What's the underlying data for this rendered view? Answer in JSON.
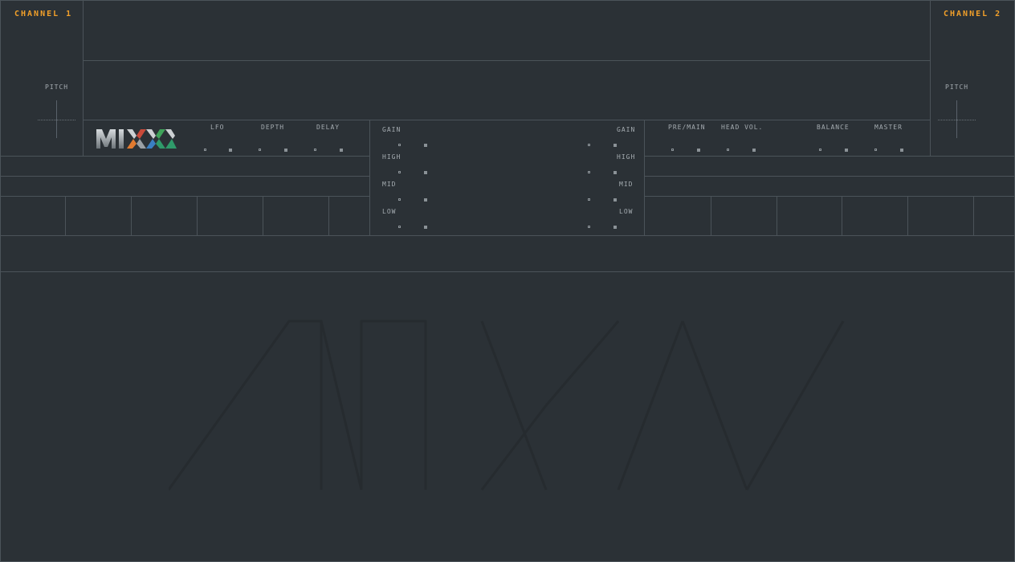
{
  "deck1": {
    "channel_label": "CHANNEL 1",
    "pitch_label": "PITCH"
  },
  "deck2": {
    "channel_label": "CHANNEL 2",
    "pitch_label": "PITCH"
  },
  "logo": {
    "text": "MIXX"
  },
  "flanger": {
    "lfo_label": "LFO",
    "depth_label": "DEPTH",
    "delay_label": "DELAY"
  },
  "eq_left": {
    "gain": "GAIN",
    "high": "HIGH",
    "mid": "MID",
    "low": "LOW"
  },
  "eq_right": {
    "gain": "GAIN",
    "high": "HIGH",
    "mid": "MID",
    "low": "LOW"
  },
  "master": {
    "pre_main_label": "PRE/MAIN",
    "head_vol_label": "HEAD VOL.",
    "balance_label": "BALANCE",
    "master_label": "MASTER"
  },
  "colors": {
    "background": "#2b3136",
    "border": "#4b5359",
    "accent": "#f2a02a"
  },
  "icons": {
    "logo": "mixxx-logo",
    "watermark": "mixxx-watermark-logo"
  }
}
